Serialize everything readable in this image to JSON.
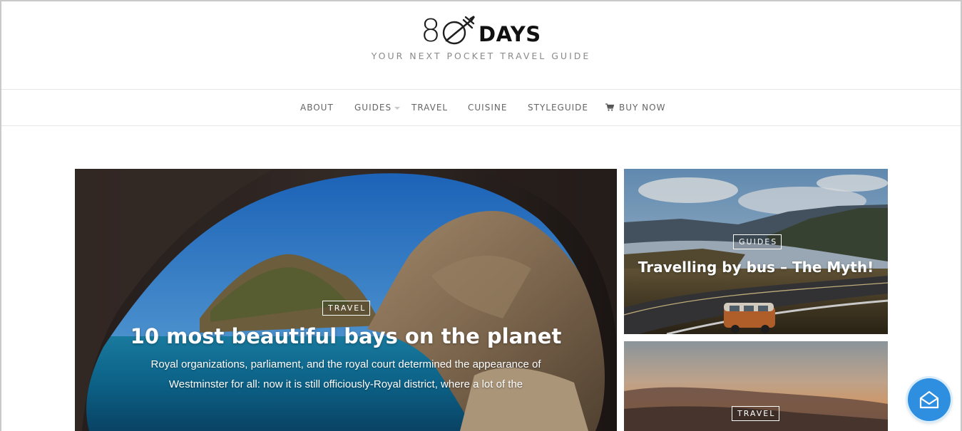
{
  "header": {
    "logo_digit": "8",
    "logo_word": "DAYS",
    "tagline": "YOUR NEXT POCKET TRAVEL GUIDE"
  },
  "nav": {
    "items": [
      {
        "label": "ABOUT"
      },
      {
        "label": "GUIDES",
        "has_dropdown": true
      },
      {
        "label": "TRAVEL"
      },
      {
        "label": "CUISINE"
      },
      {
        "label": "STYLEGUIDE"
      },
      {
        "label": "BUY NOW",
        "icon": "cart-icon"
      }
    ]
  },
  "featured": {
    "main": {
      "category": "TRAVEL",
      "title": "10 most beautiful bays on the planet",
      "excerpt_line1": "Royal organizations, parliament, and the royal court determined the appearance of",
      "excerpt_line2": "Westminster for all: now it is still officiously-Royal district, where a lot of the"
    },
    "side": [
      {
        "category": "GUIDES",
        "title": "Travelling by bus – The Myth!"
      },
      {
        "category": "TRAVEL"
      }
    ]
  },
  "subscribe": {
    "icon": "envelope-icon"
  },
  "colors": {
    "accent": "#2e8fe0",
    "nav_text": "#666666",
    "tagline": "#8a8a8a"
  }
}
